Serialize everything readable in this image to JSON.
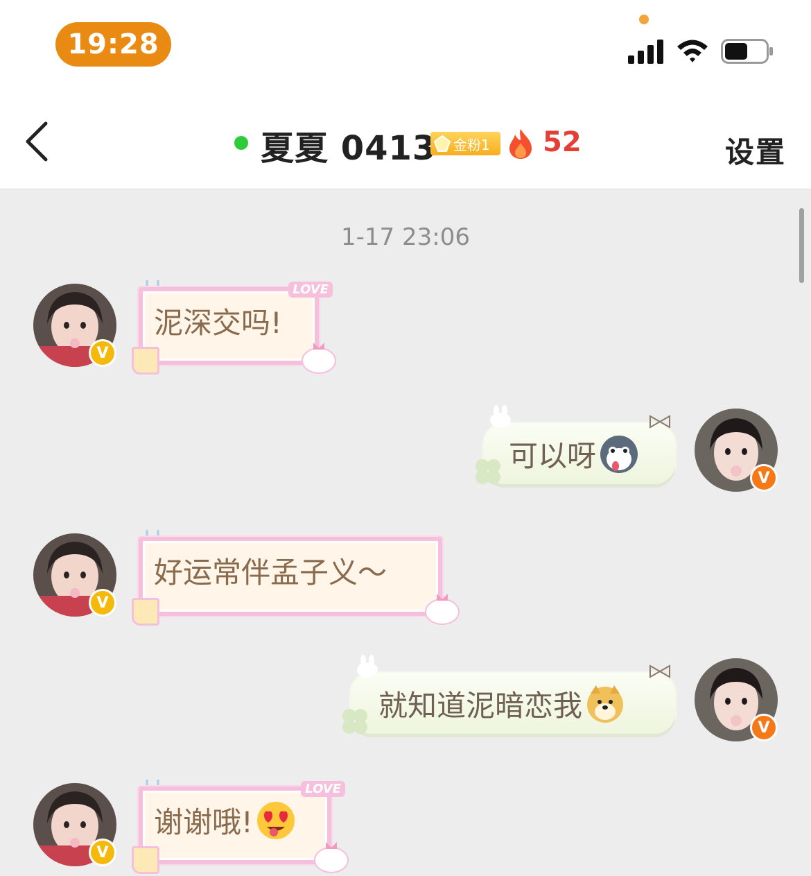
{
  "status_bar": {
    "time": "19:28"
  },
  "header": {
    "title": "夏夏 0413",
    "badge": "金粉1",
    "flame_count": "52",
    "settings": "设置",
    "online_color": "#2fcb3a"
  },
  "chat": {
    "timestamp": "1-17 23:06",
    "messages": [
      {
        "side": "left",
        "text": "泥深交吗!",
        "emoji": ""
      },
      {
        "side": "right",
        "text": "可以呀",
        "emoji": "husky-emoji"
      },
      {
        "side": "left",
        "text": "好运常伴孟子义～",
        "emoji": ""
      },
      {
        "side": "right",
        "text": "就知道泥暗恋我",
        "emoji": "doge-emoji"
      },
      {
        "side": "left",
        "text": "谢谢哦!",
        "emoji": "heart-eyes-emoji"
      }
    ]
  },
  "sticker_text": {
    "love": "LOVE"
  },
  "avatar_badge": "V"
}
